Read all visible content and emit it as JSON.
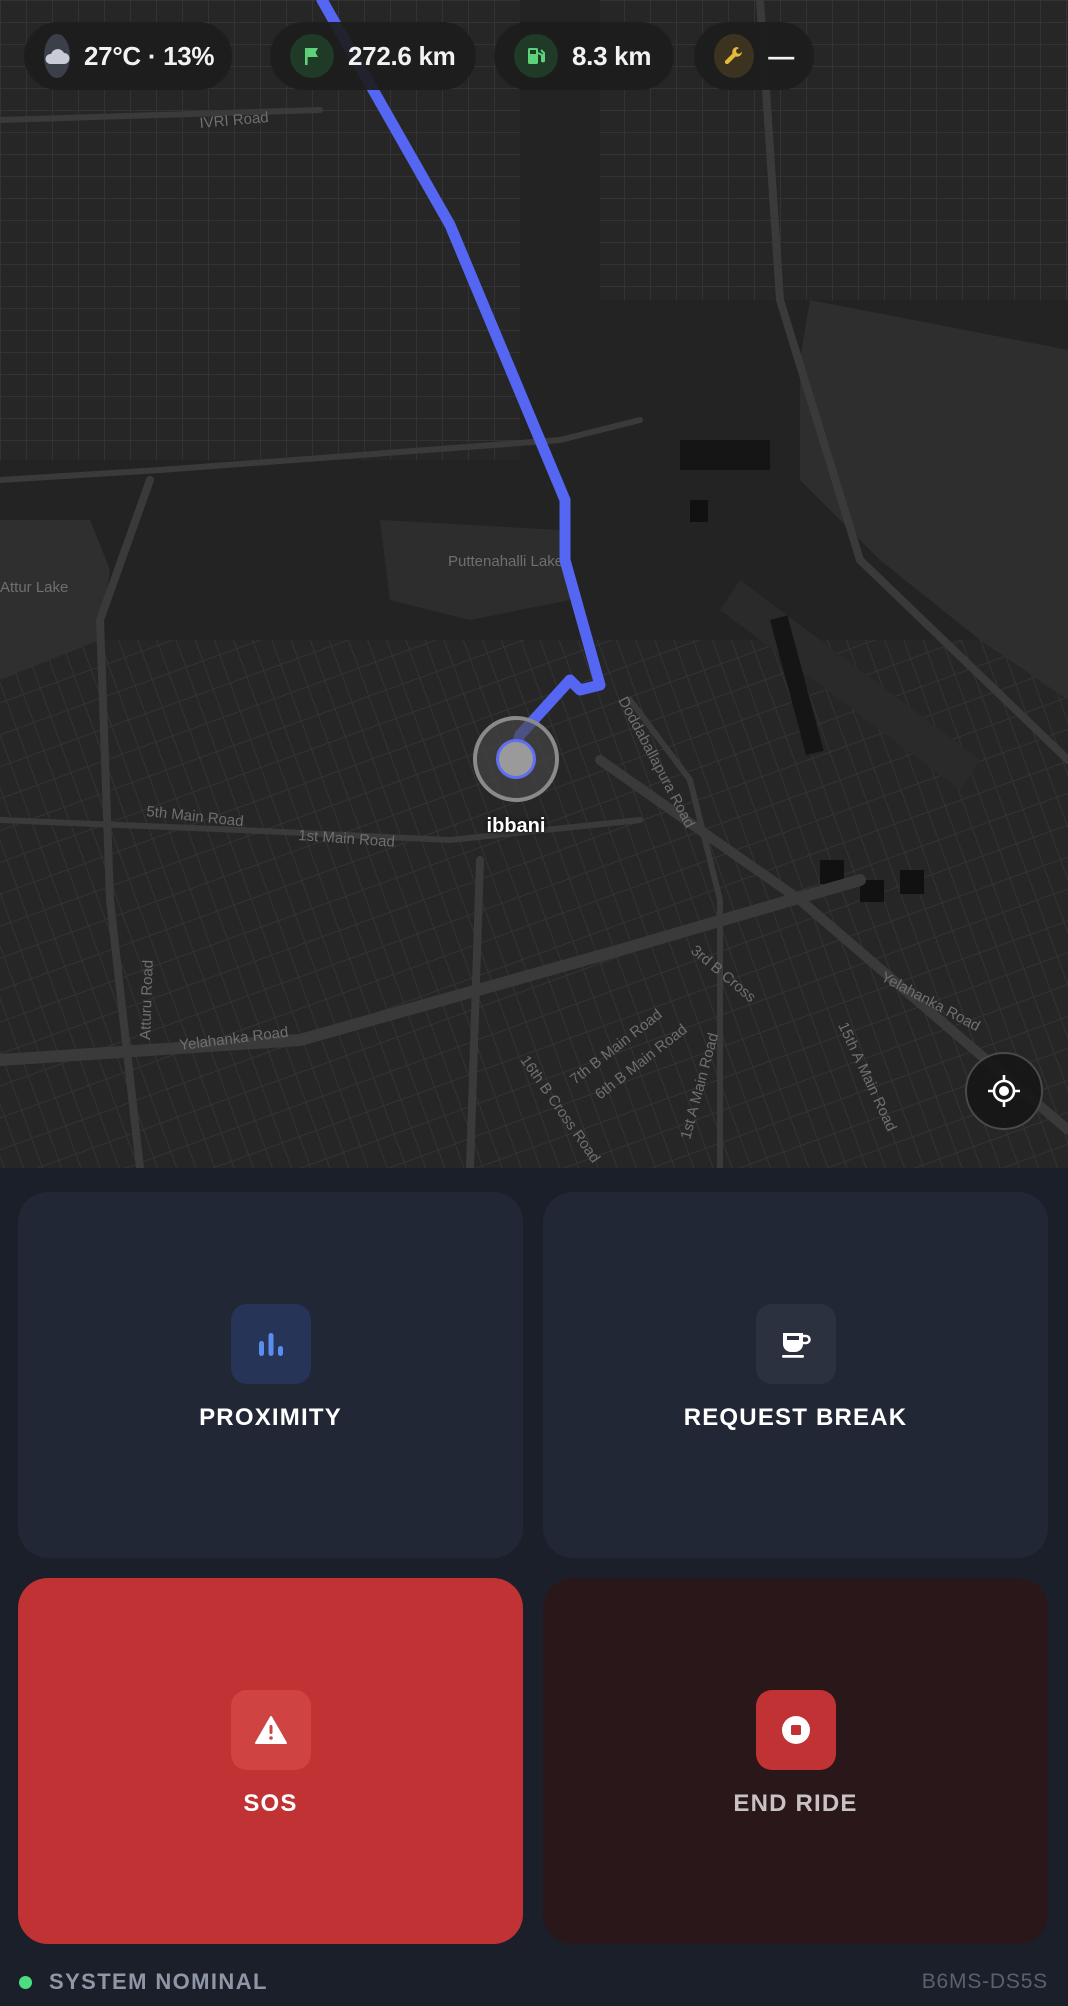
{
  "status_bar": {
    "weather": {
      "icon": "cloud-icon",
      "text": "27°C · 13%",
      "icon_bg": "#3b3f4a",
      "icon_color": "#c9ccd4"
    },
    "distance": {
      "icon": "flag-icon",
      "text": "272.6 km",
      "icon_bg": "#1f3a26",
      "icon_color": "#5fd17a"
    },
    "fuel": {
      "icon": "fuel-pump-icon",
      "text": "8.3 km",
      "icon_bg": "#1f3a26",
      "icon_color": "#5fd17a"
    },
    "service": {
      "icon": "wrench-icon",
      "text": "—",
      "icon_bg": "#3b3320",
      "icon_color": "#e7b83a"
    }
  },
  "map": {
    "street_labels": {
      "ivri_road": "IVRI Road",
      "puttenahalli_lake": "Puttenahalli Lake",
      "attur_lake": "Attur Lake",
      "fifth_main": "5th Main Road",
      "first_main": "1st Main Road",
      "yelahanka_road": "Yelahanka Road",
      "attur_road": "Atturu Road",
      "yelahanka_road_east": "Yelahanka Road",
      "sixteenth_cross": "16th B Cross Road",
      "seventh_b_main": "7th B Main Road",
      "sixth_b_main": "6th B Main Road",
      "third_b_cross": "3rd B Cross",
      "fifteenth_main": "15th A Main Road",
      "first_a_main": "1st A Main Road",
      "doddaballapur_road": "Doddaballapura Road"
    },
    "marker_label": "ibbani",
    "route_color": "#5566f2"
  },
  "controls": {
    "proximity": {
      "label": "PROXIMITY",
      "icon": "bar-chart-icon",
      "icon_bg": "#263557",
      "icon_color": "#5b8def",
      "label_color": "#ffffff"
    },
    "request_break": {
      "label": "REQUEST BREAK",
      "icon": "coffee-cup-icon",
      "icon_bg": "#2c3140",
      "icon_color": "#ffffff",
      "label_color": "#ffffff"
    },
    "sos": {
      "label": "SOS",
      "icon": "warning-triangle-icon",
      "icon_bg": "#cf4443",
      "icon_color": "#ffffff",
      "label_color": "#ffffff"
    },
    "end_ride": {
      "label": "END RIDE",
      "icon": "stop-icon",
      "icon_bg": "#c03233",
      "icon_color": "#ffffff",
      "label_color": "#c9c2c2"
    }
  },
  "footer": {
    "status_text": "SYSTEM NOMINAL",
    "status_color": "#4ade80",
    "device_id": "B6MS-DS5S"
  }
}
